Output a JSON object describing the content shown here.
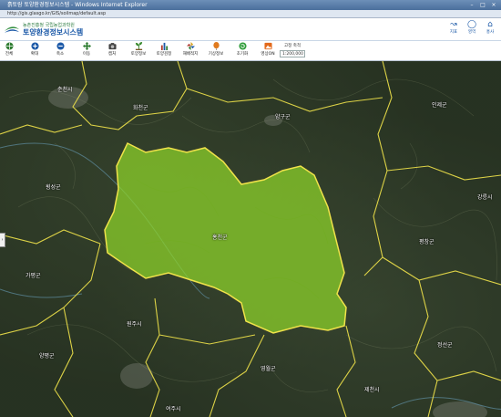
{
  "window": {
    "title": "흙토람 토양환경정보시스템 - Windows Internet Explorer",
    "url": "http://gis.glasgo.kr/GIS/soilmap/default.asp"
  },
  "header": {
    "logo_sub": "농촌진흥청 국립농업과학원",
    "logo_main": "토양환경정보시스템",
    "buttons": [
      {
        "label": "지표",
        "icon": "chart-icon"
      },
      {
        "label": "영역",
        "icon": "location-icon"
      },
      {
        "label": "홍사",
        "icon": "home-icon"
      }
    ]
  },
  "toolbar": {
    "tools": [
      {
        "label": "전체",
        "icon": "globe-icon",
        "color": "#2f7d32"
      },
      {
        "label": "확대",
        "icon": "zoom-in-icon",
        "color": "#1d5aa8"
      },
      {
        "label": "축소",
        "icon": "zoom-out-icon",
        "color": "#1d5aa8"
      },
      {
        "label": "이동",
        "icon": "move-icon",
        "color": "#2f7d32"
      },
      {
        "label": "캡처",
        "icon": "camera-icon",
        "color": "#444444"
      },
      {
        "label": "토양정보",
        "icon": "plant-icon",
        "color": "#3a8a2e"
      },
      {
        "label": "토양검정",
        "icon": "bar-chart-icon",
        "color": "#b03a2e"
      },
      {
        "label": "재배적지",
        "icon": "pinwheel-icon",
        "color": "#d6a21e"
      },
      {
        "label": "기상정보",
        "icon": "balloon-icon",
        "color": "#e07b1f"
      },
      {
        "label": "초기화",
        "icon": "refresh-icon",
        "color": "#2f9d3a"
      },
      {
        "label": "영상ON",
        "icon": "image-toggle-icon",
        "color": "#e36a1c"
      }
    ],
    "scale": {
      "label": "고정 축척",
      "value": "1:200,000"
    }
  },
  "map": {
    "highlight_color": "#8fd62a",
    "boundary_color": "#f0e34a",
    "places": [
      {
        "name": "춘천시"
      },
      {
        "name": "화천군"
      },
      {
        "name": "양구군"
      },
      {
        "name": "인제군"
      },
      {
        "name": "홍천군"
      },
      {
        "name": "횡성군"
      },
      {
        "name": "가평군"
      },
      {
        "name": "강릉시"
      },
      {
        "name": "평창군"
      },
      {
        "name": "원주시"
      },
      {
        "name": "정선군"
      },
      {
        "name": "양평군"
      },
      {
        "name": "영월군"
      },
      {
        "name": "제천시"
      },
      {
        "name": "여주시"
      }
    ]
  }
}
